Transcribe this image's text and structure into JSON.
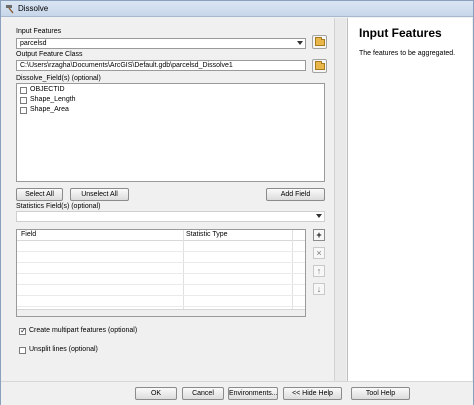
{
  "window": {
    "title": "Dissolve"
  },
  "form": {
    "input_features": {
      "label": "Input Features",
      "value": "parcelsd"
    },
    "output_feature_class": {
      "label": "Output Feature Class",
      "value": "C:\\Users\\rzagha\\Documents\\ArcGIS\\Default.gdb\\parcelsd_Dissolve1"
    },
    "dissolve_fields": {
      "label": "Dissolve_Field(s) (optional)",
      "items": [
        {
          "label": "OBJECTID",
          "checked": false
        },
        {
          "label": "Shape_Length",
          "checked": false
        },
        {
          "label": "Shape_Area",
          "checked": false
        }
      ]
    },
    "buttons": {
      "select_all": "Select All",
      "unselect_all": "Unselect All",
      "add_field": "Add Field"
    },
    "statistics": {
      "label": "Statistics Field(s) (optional)",
      "combo_value": "",
      "columns": [
        "Field",
        "Statistic Type"
      ]
    },
    "side_buttons": {
      "add": "+",
      "remove": "×",
      "up": "↑",
      "down": "↓"
    },
    "multipart": {
      "label": "Create multipart features (optional)",
      "checked": true
    },
    "unsplit": {
      "label": "Unsplit lines (optional)",
      "checked": false
    }
  },
  "help": {
    "title": "Input Features",
    "text": "The features to be aggregated."
  },
  "footer": {
    "ok": "OK",
    "cancel": "Cancel",
    "environments": "Environments...",
    "hide_help": "<< Hide Help",
    "tool_help": "Tool Help"
  }
}
